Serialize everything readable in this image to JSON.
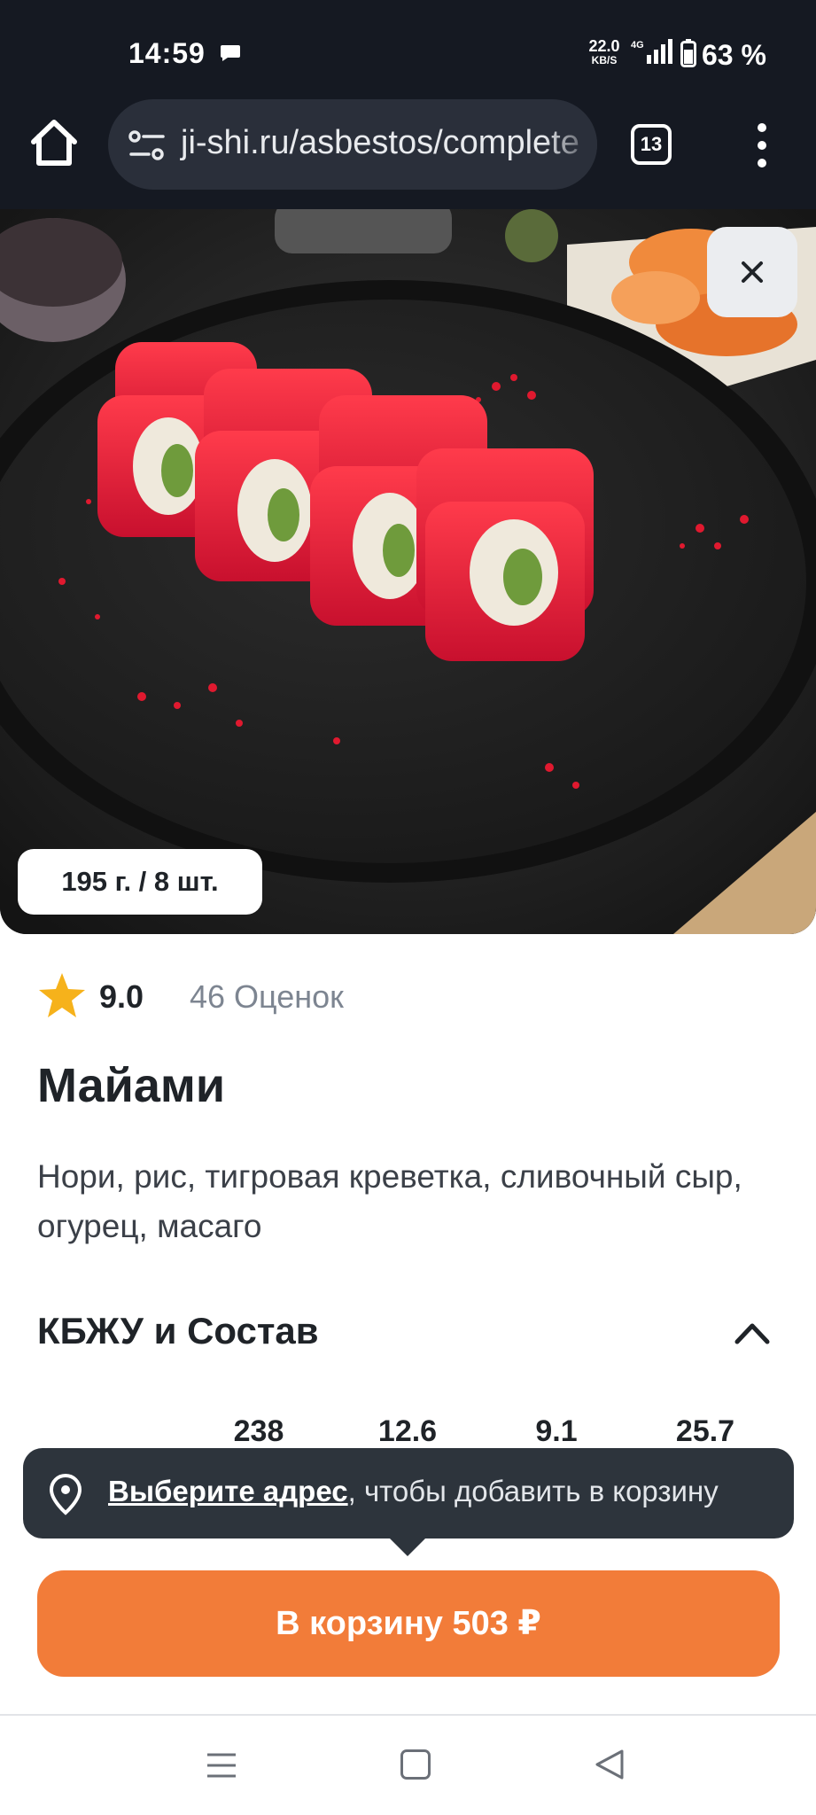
{
  "status_bar": {
    "time": "14:59",
    "net_speed_value": "22.0",
    "net_speed_unit": "KB/S",
    "network": "4G",
    "battery": "63 %"
  },
  "browser": {
    "url": "ji-shi.ru/asbestos/complete",
    "tab_count": "13"
  },
  "product": {
    "weight_badge": "195 г. / 8 шт.",
    "rating": "9.0",
    "rating_count": "46 Оценок",
    "title": "Майами",
    "description": "Нори, рис, тигровая креветка, сливочный сыр, огурец, масаго",
    "section_title": "КБЖУ и Состав",
    "nutrition": [
      "238",
      "12.6",
      "9.1",
      "25.7"
    ]
  },
  "tooltip": {
    "link": "Выберите адрес",
    "rest": ", чтобы добавить в корзину"
  },
  "cart": {
    "label": "В корзину 503 ₽"
  },
  "colors": {
    "accent": "#f27c39",
    "dark_bar": "#151922",
    "tooltip_bg": "#2d343c",
    "star": "#f6b21b"
  }
}
